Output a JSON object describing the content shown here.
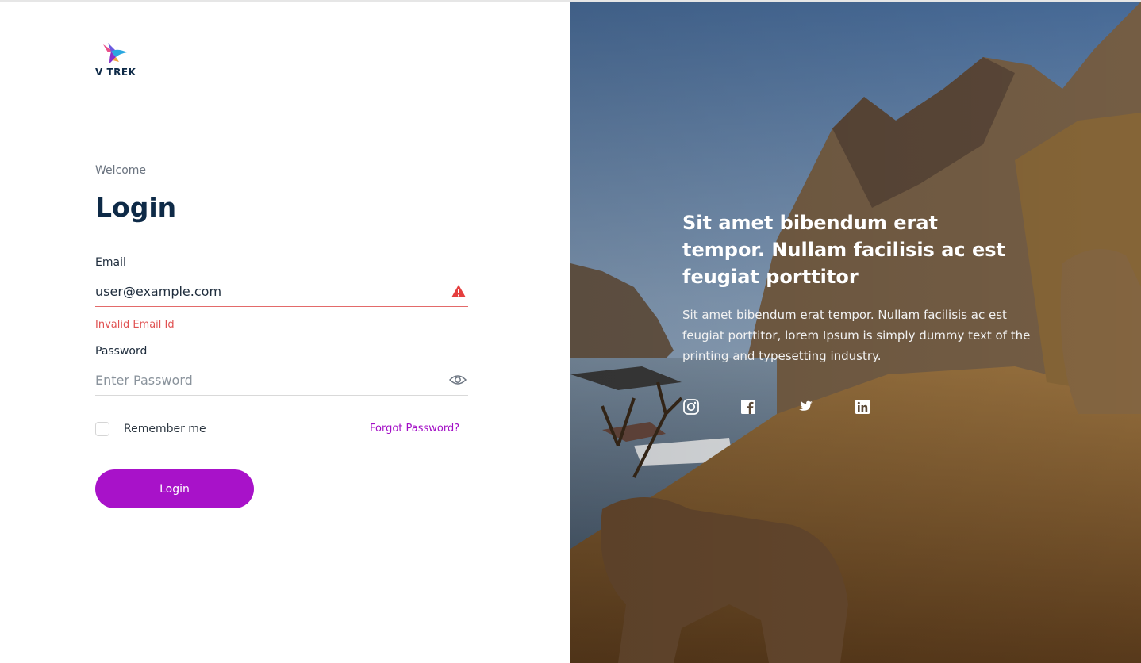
{
  "brand": {
    "logo_text": "V TREK"
  },
  "login": {
    "welcome": "Welcome",
    "title": "Login",
    "email_label": "Email",
    "email_value": "user@example.com",
    "email_error": "Invalid Email Id",
    "password_label": "Password",
    "password_placeholder": "Enter Password",
    "remember_label": "Remember me",
    "forgot_label": "Forgot Password?",
    "submit_label": "Login"
  },
  "hero": {
    "title": "Sit amet bibendum erat tempor. Nullam facilisis ac est feugiat porttitor",
    "text": "Sit amet bibendum erat tempor. Nullam facilisis ac est feugiat porttitor, lorem Ipsum is simply dummy text of the printing and typesetting industry.",
    "social_icons": [
      "instagram-icon",
      "facebook-icon",
      "twitter-icon",
      "linkedin-icon"
    ]
  },
  "colors": {
    "accent": "#a812c9",
    "error": "#e05252",
    "heading": "#0e2a47"
  }
}
